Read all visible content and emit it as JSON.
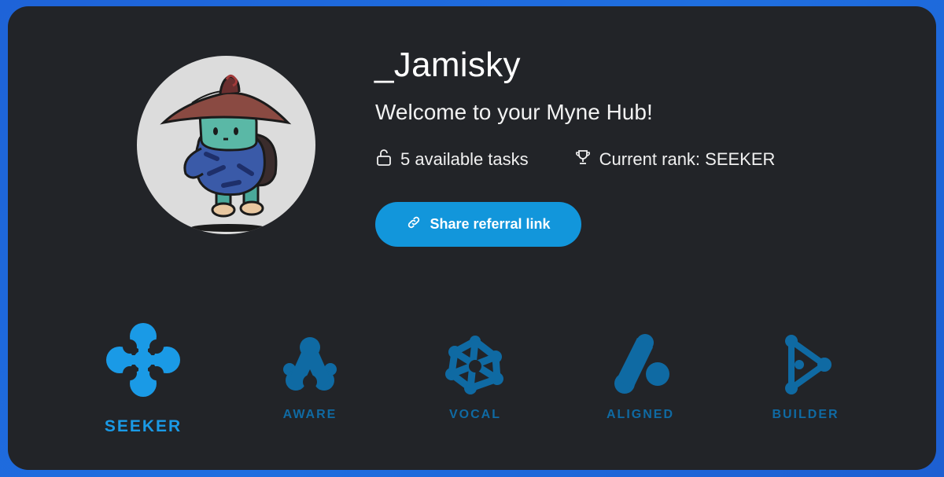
{
  "profile": {
    "username": "_Jamisky",
    "welcome": "Welcome to your Myne Hub!",
    "avatar": "avatar-image"
  },
  "stats": {
    "tasks_label": "5 available tasks",
    "tasks_icon": "unlock-icon",
    "rank_label": "Current rank: SEEKER",
    "rank_icon": "trophy-icon"
  },
  "share": {
    "label": "Share referral link",
    "icon": "link-icon"
  },
  "ranks": [
    {
      "label": "SEEKER",
      "icon": "seeker-icon",
      "active": true
    },
    {
      "label": "AWARE",
      "icon": "aware-icon",
      "active": false
    },
    {
      "label": "VOCAL",
      "icon": "vocal-icon",
      "active": false
    },
    {
      "label": "ALIGNED",
      "icon": "aligned-icon",
      "active": false
    },
    {
      "label": "BUILDER",
      "icon": "builder-icon",
      "active": false
    }
  ],
  "colors": {
    "background": "#1f6fe0",
    "card": "#222428",
    "accent": "#1296db",
    "rank_active": "#1a9ae6",
    "rank_inactive": "#0f6aa3"
  }
}
